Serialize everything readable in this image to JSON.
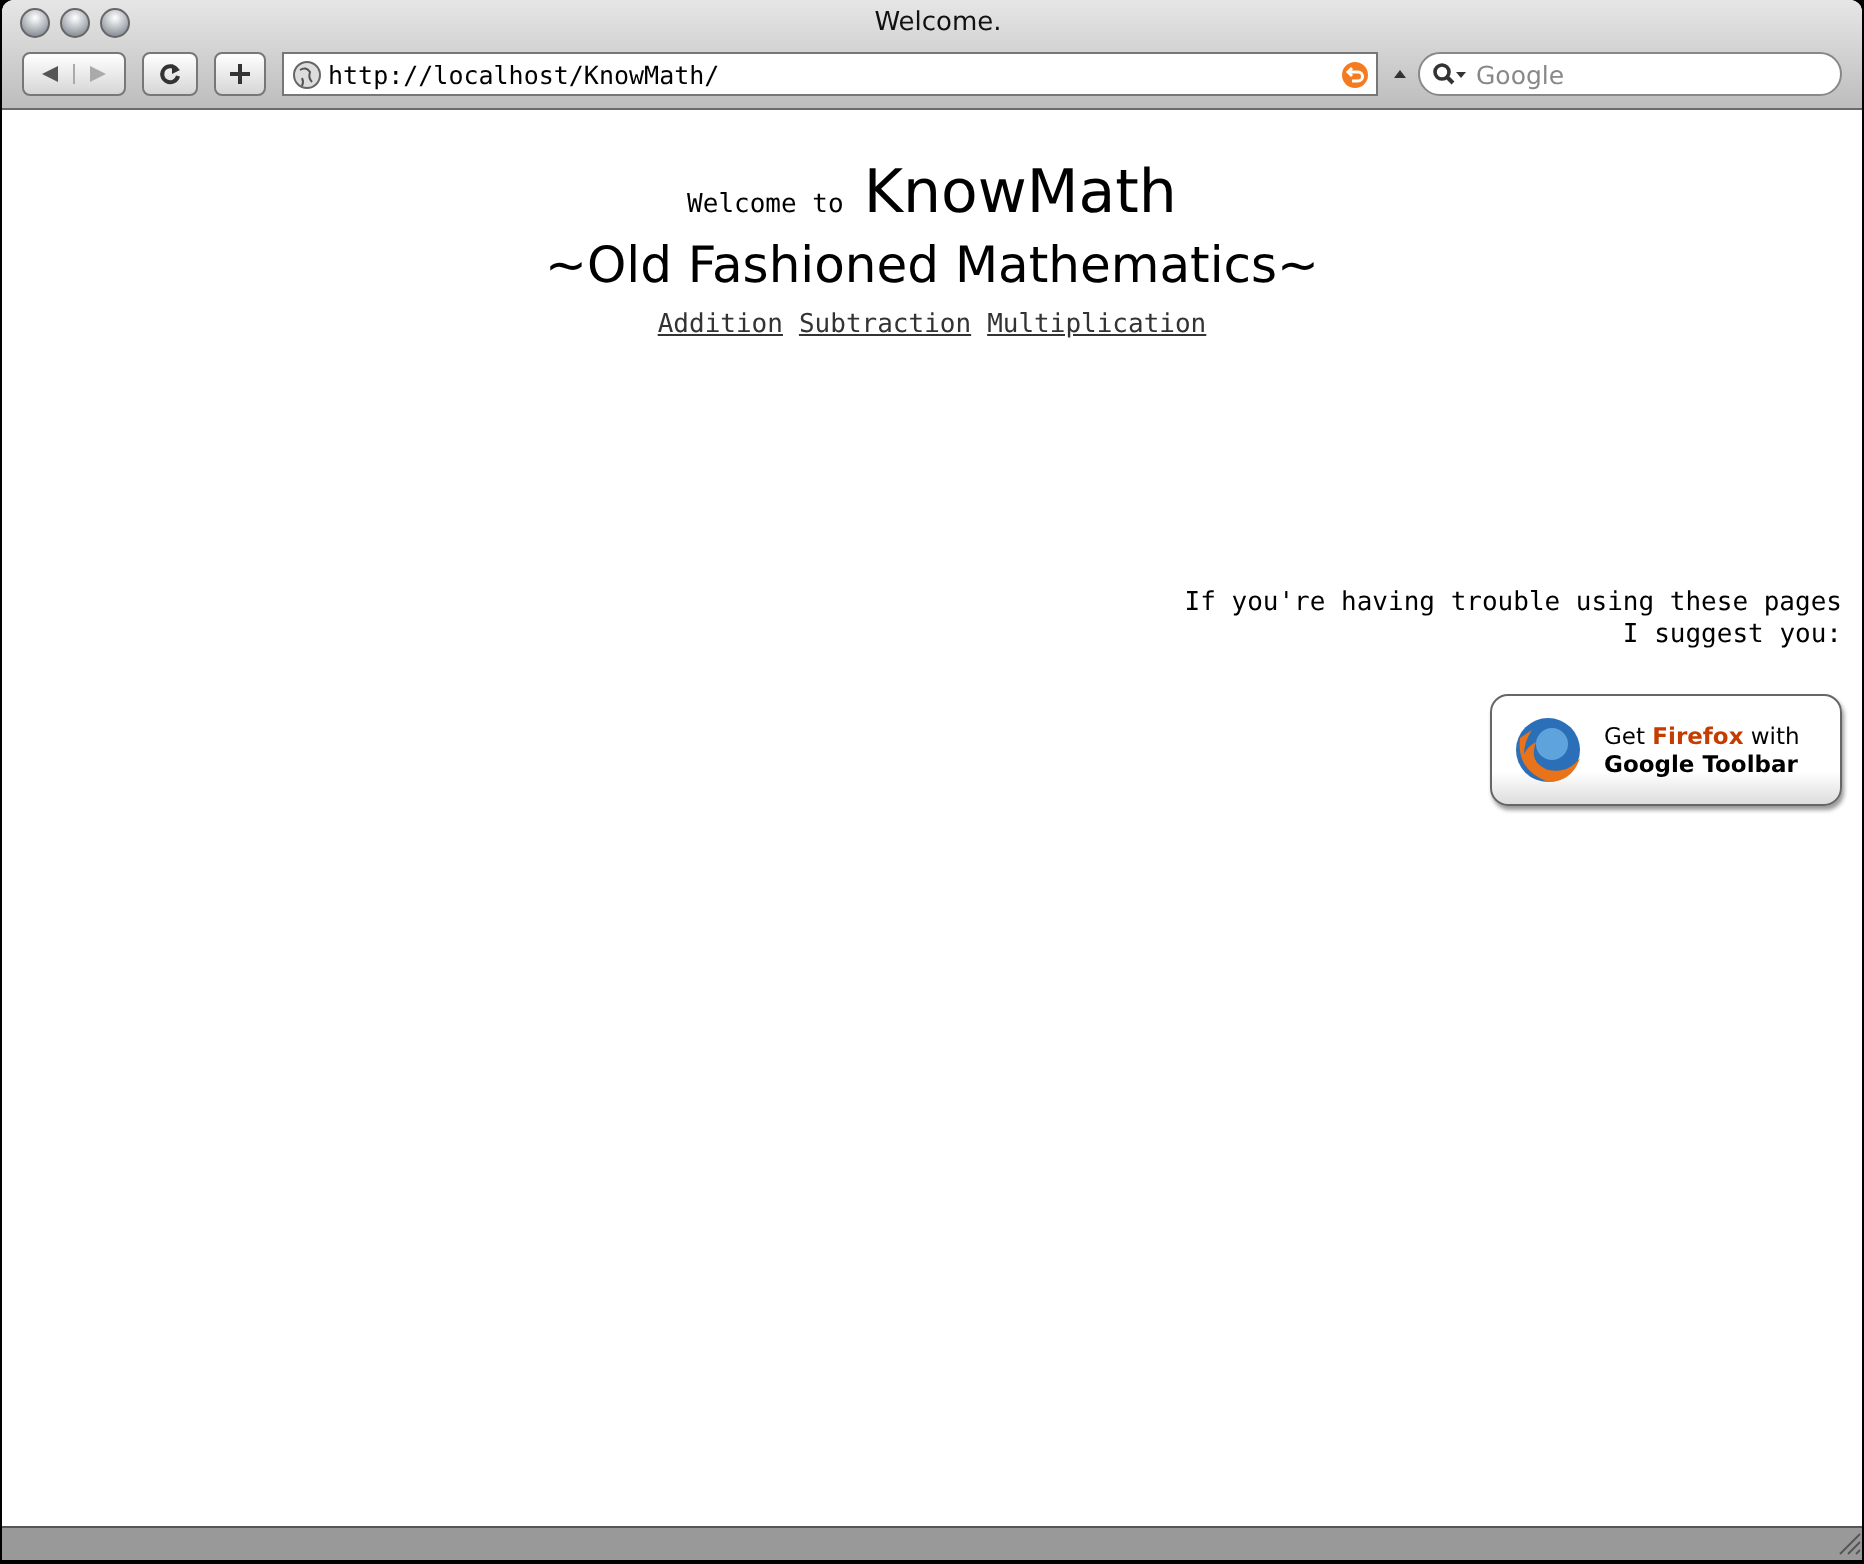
{
  "window": {
    "title": "Welcome."
  },
  "toolbar": {
    "url": "http://localhost/KnowMath/",
    "search": {
      "placeholder": "Google"
    }
  },
  "page": {
    "welcome": "Welcome to",
    "brand": "KnowMath",
    "subtitle": "~Old Fashioned Mathematics~",
    "links": [
      "Addition",
      "Subtraction",
      "Multiplication"
    ],
    "notice": [
      "If you're having trouble using these pages",
      "I suggest you:"
    ],
    "promo": {
      "line1": "Get **Firefox** with",
      "line2": "Google Toolbar"
    }
  }
}
